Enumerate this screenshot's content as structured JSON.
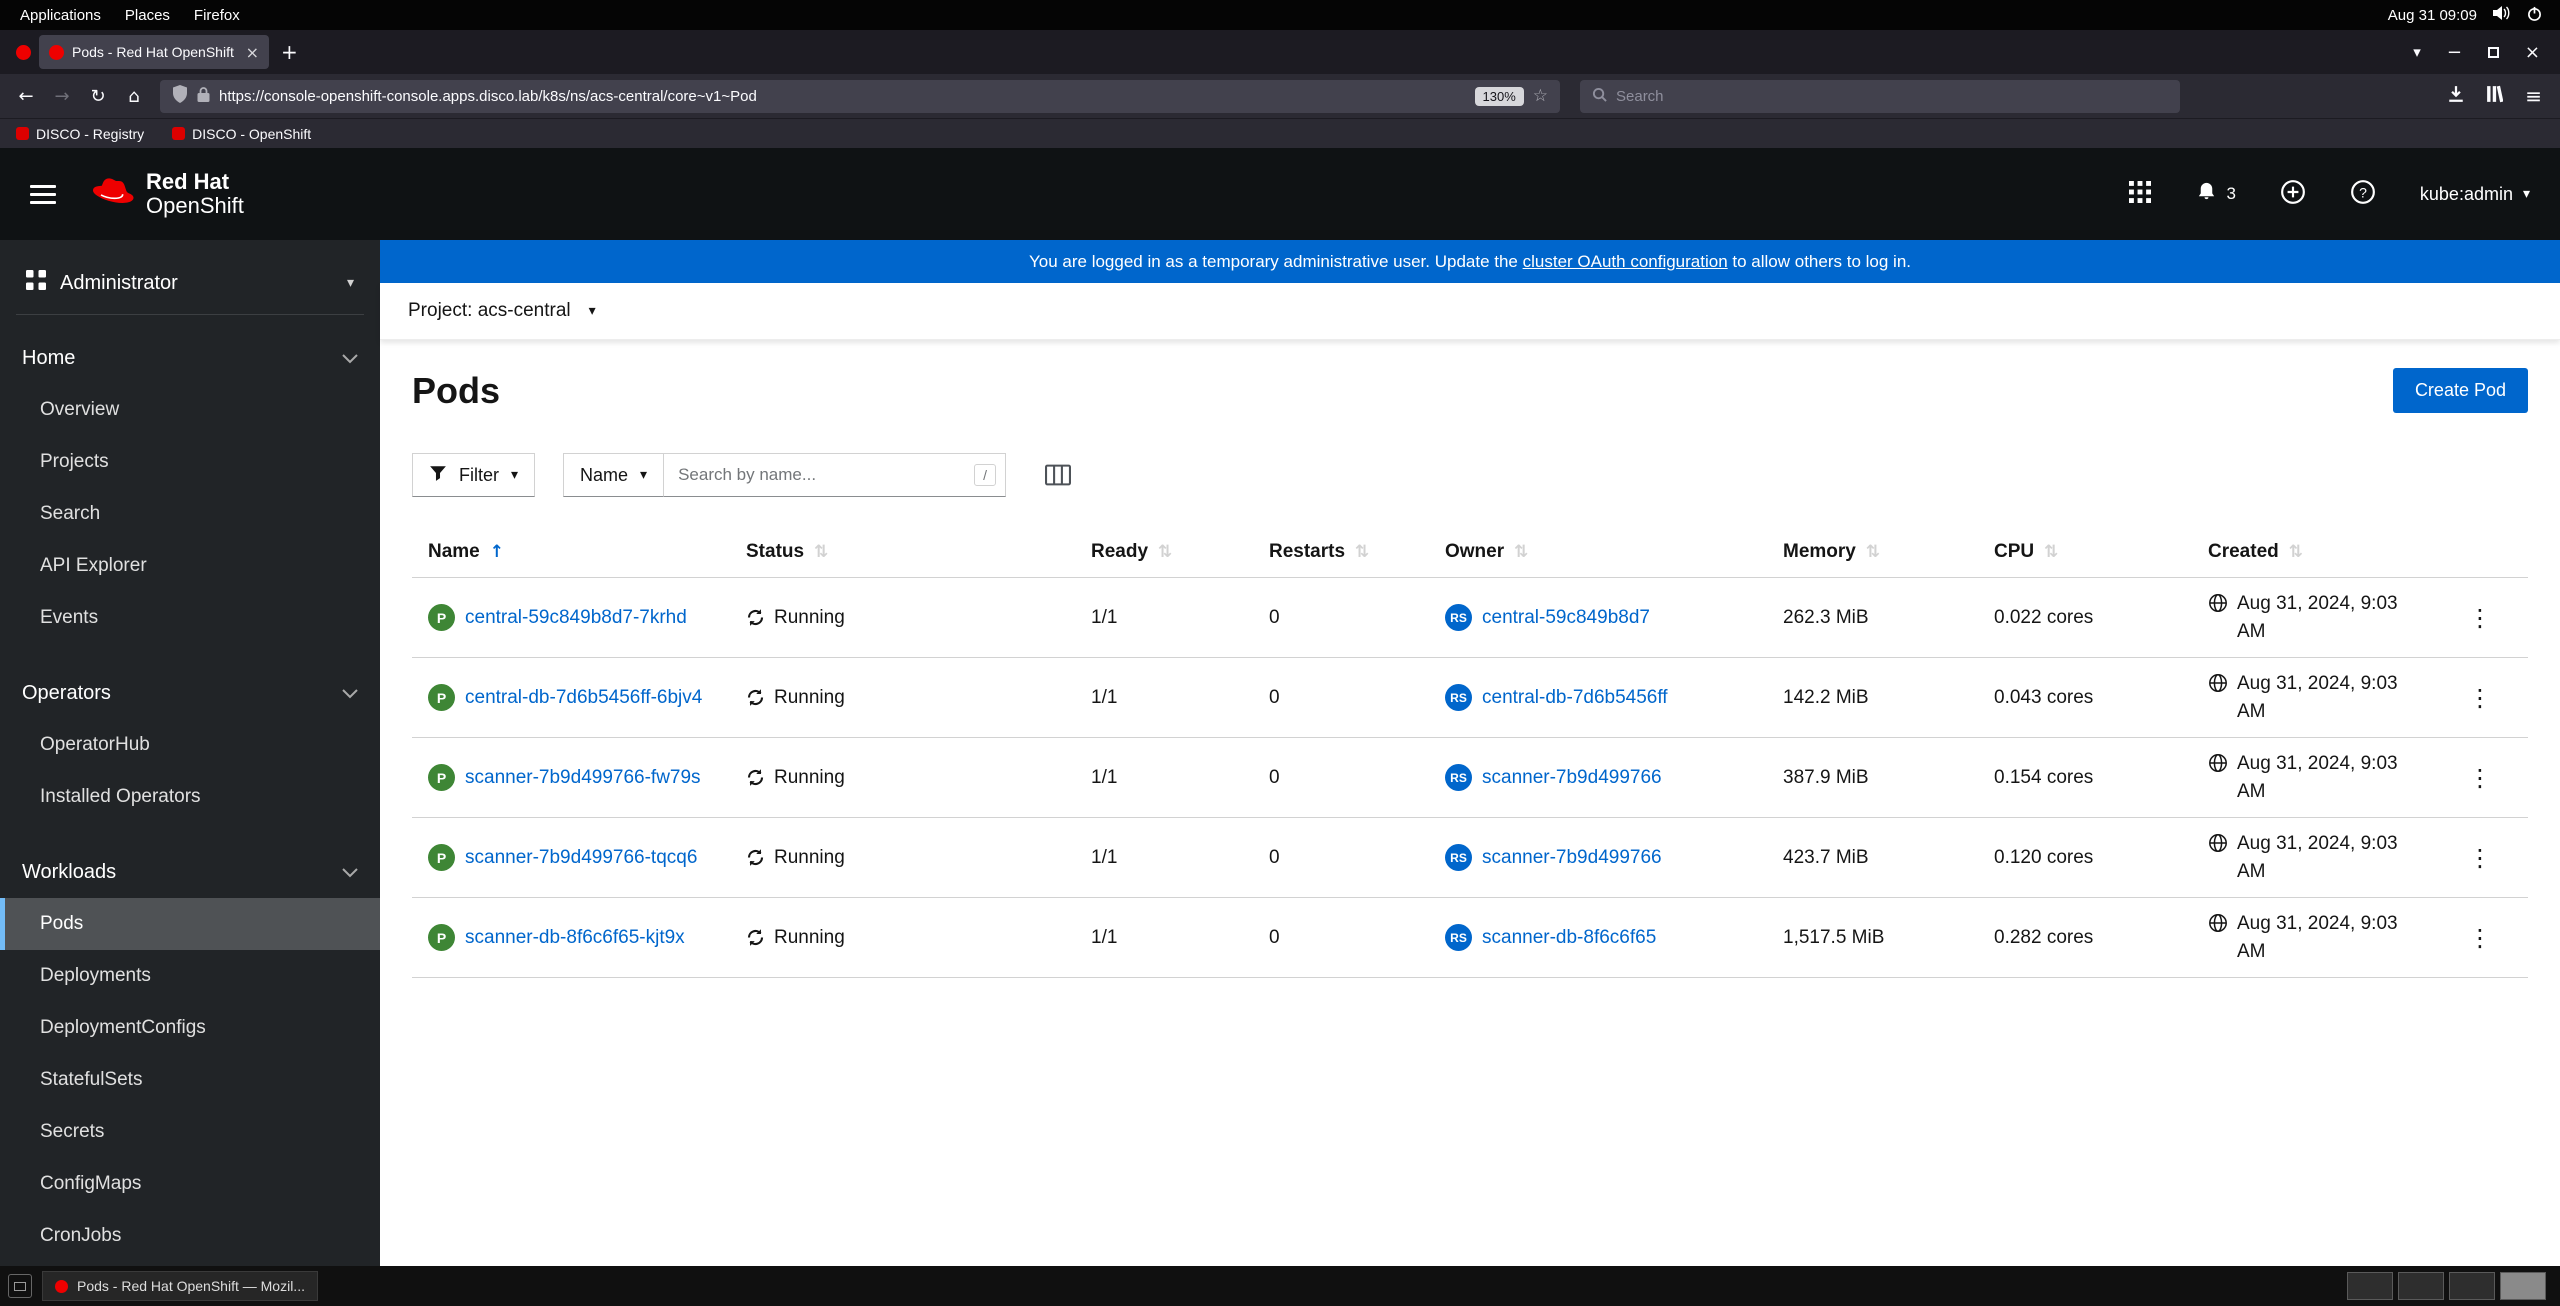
{
  "colors": {
    "accent": "#0066cc",
    "banner": "#0066cc",
    "pod_badge": "#3e8635",
    "replicaset_badge": "#0066cc",
    "masthead": "#0f1214",
    "sidebar": "#212427"
  },
  "icons": {
    "caret_down": "▾",
    "kebab": "⋮",
    "close": "×",
    "plus_tab": "+",
    "back": "←",
    "forward": "→",
    "reload": "↻",
    "home": "⌂",
    "star": "☆",
    "hamburger": "≡",
    "minimize": "−",
    "sort_asc": "↑",
    "sort_both": "⇅",
    "list_tabs": "▾"
  },
  "desktop": {
    "top_bar": {
      "menus": [
        "Applications",
        "Places",
        "Firefox"
      ],
      "clock": "Aug 31 09:09"
    },
    "taskbar": {
      "window_title": "Pods - Red Hat OpenShift — Mozil...",
      "workspace_count": "4"
    }
  },
  "browser": {
    "tab_title": "Pods - Red Hat OpenShift",
    "url": "https://console-openshift-console.apps.disco.lab/k8s/ns/acs-central/core~v1~Pod",
    "zoom": "130%",
    "search_placeholder": "Search",
    "bookmarks": [
      {
        "label": "DISCO - Registry"
      },
      {
        "label": "DISCO - OpenShift"
      }
    ]
  },
  "masthead": {
    "brand_line1": "Red Hat",
    "brand_line2": "OpenShift",
    "notification_count": "3",
    "user": "kube:admin",
    "help_glyph": "?"
  },
  "banner": {
    "text_before": "You are logged in as a temporary administrative user. Update the ",
    "link": "cluster OAuth configuration",
    "text_after": " to allow others to log in."
  },
  "project_bar": {
    "label": "Project: acs-central"
  },
  "sidebar": {
    "perspective": "Administrator",
    "sections": [
      {
        "label": "Home",
        "items": [
          "Overview",
          "Projects",
          "Search",
          "API Explorer",
          "Events"
        ]
      },
      {
        "label": "Operators",
        "items": [
          "OperatorHub",
          "Installed Operators"
        ]
      },
      {
        "label": "Workloads",
        "items": [
          "Pods",
          "Deployments",
          "DeploymentConfigs",
          "StatefulSets",
          "Secrets",
          "ConfigMaps",
          "CronJobs"
        ]
      }
    ],
    "active_item": "Pods"
  },
  "page": {
    "title": "Pods",
    "create_button": "Create Pod",
    "toolbar": {
      "filter_label": "Filter",
      "attribute_label": "Name",
      "search_placeholder": "Search by name...",
      "shortcut": "/"
    }
  },
  "table": {
    "columns": [
      "Name",
      "Status",
      "Ready",
      "Restarts",
      "Owner",
      "Memory",
      "CPU",
      "Created"
    ],
    "badges": {
      "pod": "P",
      "replicaset": "RS"
    },
    "rows": [
      {
        "name": "central-59c849b8d7-7krhd",
        "status": "Running",
        "ready": "1/1",
        "restarts": "0",
        "owner": "central-59c849b8d7",
        "memory": "262.3 MiB",
        "cpu": "0.022 cores",
        "created": "Aug 31, 2024, 9:03 AM"
      },
      {
        "name": "central-db-7d6b5456ff-6bjv4",
        "status": "Running",
        "ready": "1/1",
        "restarts": "0",
        "owner": "central-db-7d6b5456ff",
        "memory": "142.2 MiB",
        "cpu": "0.043 cores",
        "created": "Aug 31, 2024, 9:03 AM"
      },
      {
        "name": "scanner-7b9d499766-fw79s",
        "status": "Running",
        "ready": "1/1",
        "restarts": "0",
        "owner": "scanner-7b9d499766",
        "memory": "387.9 MiB",
        "cpu": "0.154 cores",
        "created": "Aug 31, 2024, 9:03 AM"
      },
      {
        "name": "scanner-7b9d499766-tqcq6",
        "status": "Running",
        "ready": "1/1",
        "restarts": "0",
        "owner": "scanner-7b9d499766",
        "memory": "423.7 MiB",
        "cpu": "0.120 cores",
        "created": "Aug 31, 2024, 9:03 AM"
      },
      {
        "name": "scanner-db-8f6c6f65-kjt9x",
        "status": "Running",
        "ready": "1/1",
        "restarts": "0",
        "owner": "scanner-db-8f6c6f65",
        "memory": "1,517.5 MiB",
        "cpu": "0.282 cores",
        "created": "Aug 31, 2024, 9:03 AM"
      }
    ]
  }
}
